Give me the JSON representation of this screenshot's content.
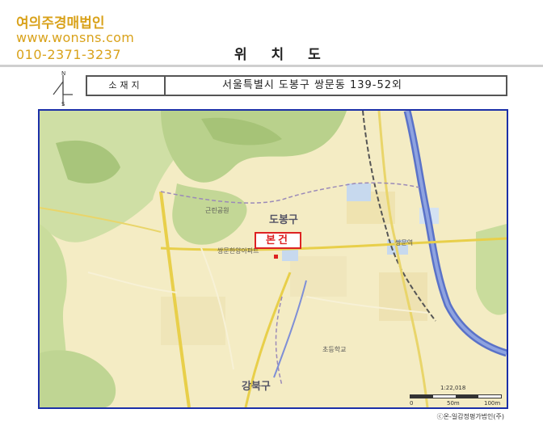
{
  "brand": {
    "name": "여의주경매법인",
    "website": "www.wonsns.com",
    "phone": "010-2371-3237"
  },
  "title": "위 치 도",
  "compass": {
    "north": "N",
    "south": "S"
  },
  "location": {
    "label": "소재지",
    "address": "서울특별시 도봉구 쌍문동 139-52외"
  },
  "map": {
    "target_label": "본건",
    "district_labels": {
      "dobong": "도봉구",
      "gangbuk": "강북구"
    },
    "labels": {
      "apartment": "쌍문한양아파트",
      "station": "쌍문역",
      "park": "근린공원",
      "school": "초등학교"
    },
    "colors": {
      "frame": "#1b2fa8",
      "target": "#dd2222",
      "river": "#5a72c8"
    }
  },
  "scale": {
    "ratio": "1:22,018",
    "marks": [
      "0",
      "50m",
      "100m"
    ]
  },
  "credit": "ⓒ온-일감정평가법인(주)"
}
